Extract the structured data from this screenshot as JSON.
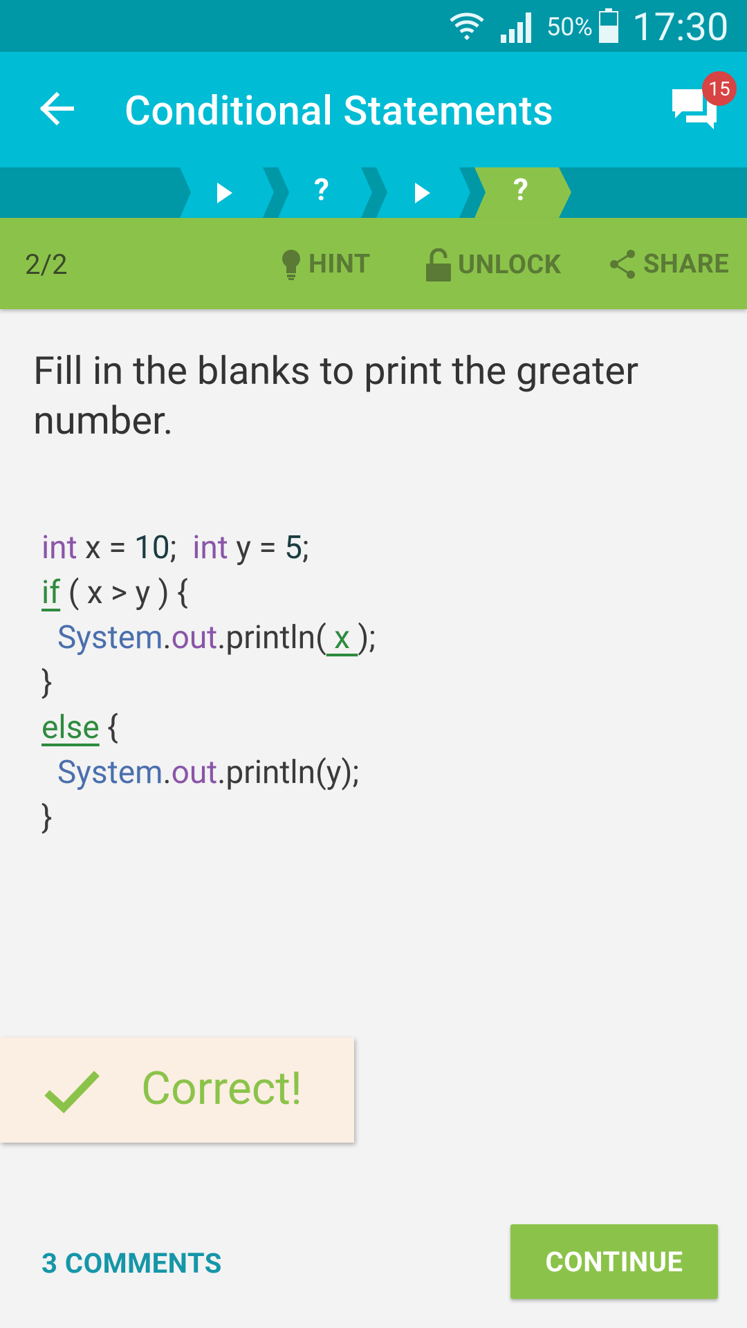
{
  "status_bar": {
    "battery_percent": "50%",
    "time": "17:30",
    "icons": [
      "wifi-icon",
      "signal-icon",
      "battery-icon"
    ]
  },
  "app_bar": {
    "title": "Conditional Statements",
    "notification_count": "15",
    "icons": [
      "back-arrow-icon",
      "chat-bubbles-icon"
    ]
  },
  "steps": {
    "items": [
      {
        "type": "lesson",
        "glyph": "play-icon"
      },
      {
        "type": "quiz",
        "label": "?"
      },
      {
        "type": "lesson",
        "glyph": "play-icon"
      },
      {
        "type": "quiz",
        "label": "?",
        "active": true
      }
    ]
  },
  "toolbar": {
    "counter": "2/2",
    "hint_label": "HINT",
    "unlock_label": "UNLOCK",
    "share_label": "SHARE"
  },
  "question": {
    "text": "Fill in the blanks to print the greater number."
  },
  "code": {
    "l1_kw1": "int",
    "l1_t1": " x = ",
    "l1_n1": "10",
    "l1_t2": ";  ",
    "l1_kw2": "int",
    "l1_t3": " y = ",
    "l1_n2": "5",
    "l1_t4": ";",
    "l2_kw": "if",
    "l2_rest": " ( x > y ) {",
    "l3_indent": "  ",
    "l3_cls": "System",
    "l3_dot": ".",
    "l3_fld": "out",
    "l3_call": ".println(",
    "l3_blank": " x ",
    "l3_end": ");",
    "l4": "}",
    "l5_kw": "else",
    "l5_rest": " {",
    "l6_indent": "  ",
    "l6_cls": "System",
    "l6_dot": ".",
    "l6_fld": "out",
    "l6_call": ".println(y);",
    "l7": "}"
  },
  "feedback": {
    "text": "Correct!",
    "accent": "#8bc34a"
  },
  "footer": {
    "comments_label": "3 COMMENTS",
    "continue_label": "CONTINUE"
  },
  "colors": {
    "app_bar": "#00bcd4",
    "status_bar": "#0097a7",
    "toolbar": "#8bc34a",
    "link": "#1596a8"
  }
}
